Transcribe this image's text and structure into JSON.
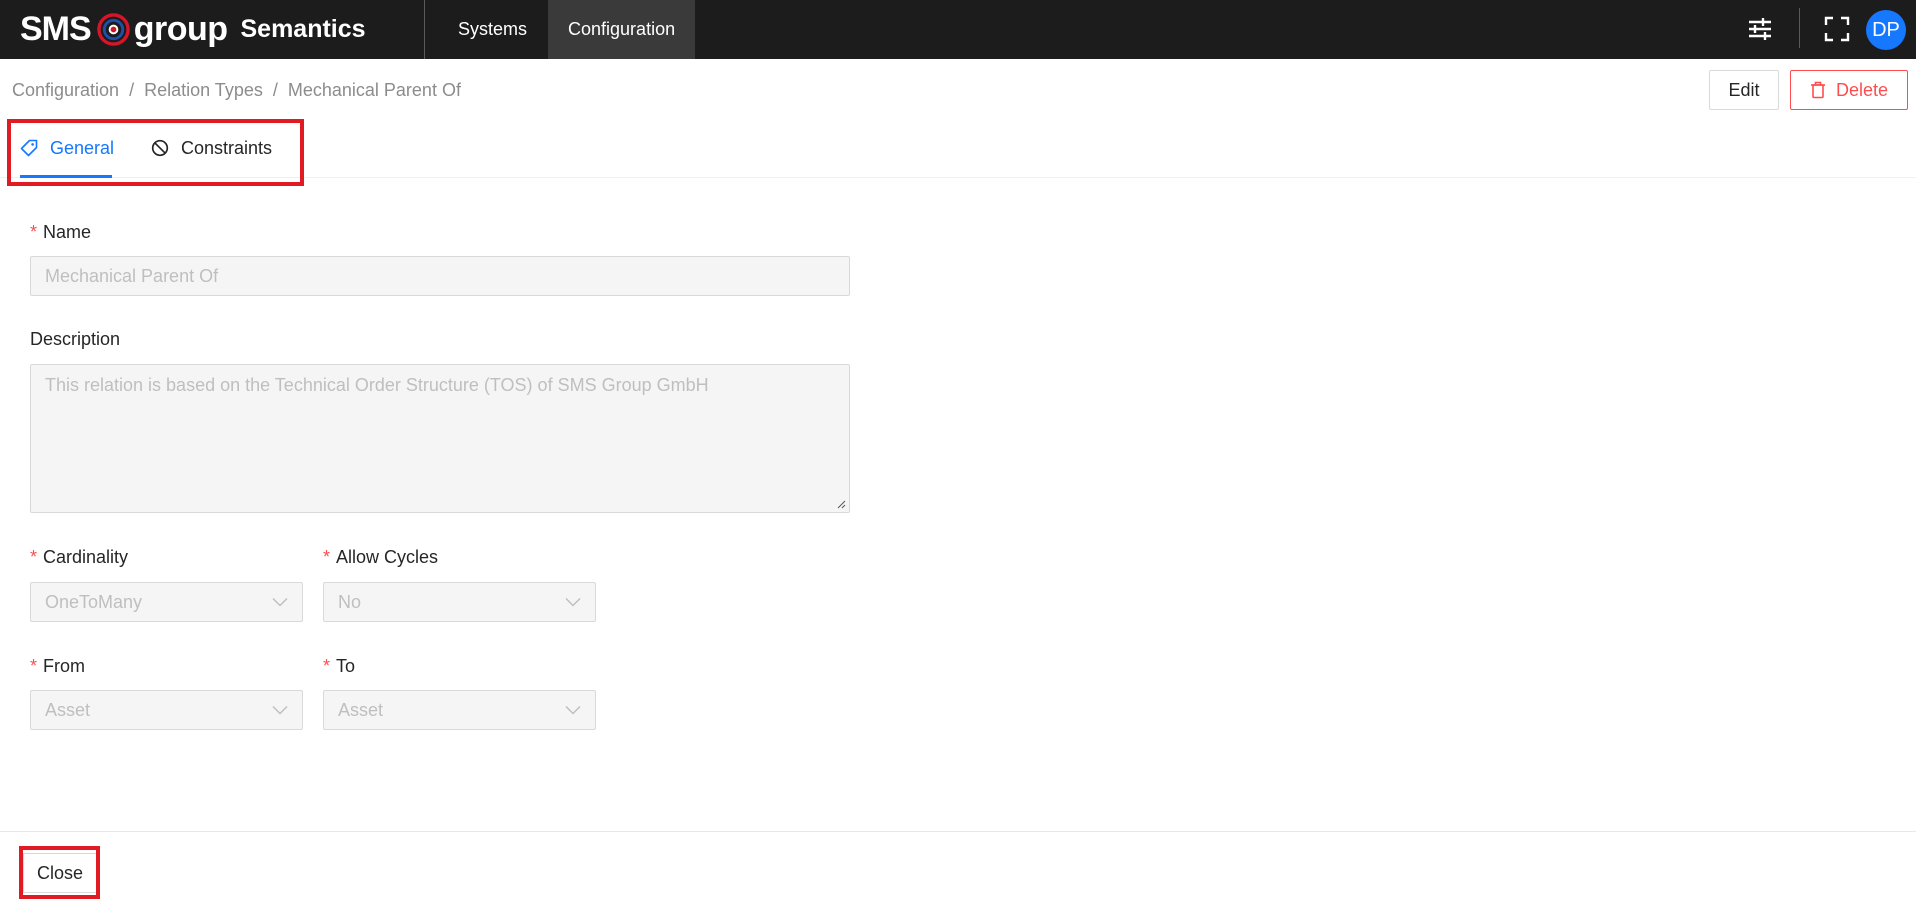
{
  "header": {
    "brand_sms": "SMS",
    "brand_group": "group",
    "brand_product": "Semantics",
    "nav": [
      {
        "label": "Systems",
        "active": false
      },
      {
        "label": "Configuration",
        "active": true
      }
    ],
    "avatar_initials": "DP",
    "icons": {
      "settings": "sliders-icon",
      "fullscreen": "fullscreen-icon"
    }
  },
  "breadcrumb": {
    "items": [
      "Configuration",
      "Relation Types",
      "Mechanical Parent Of"
    ],
    "separator": "/"
  },
  "actions": {
    "edit_label": "Edit",
    "delete_label": "Delete"
  },
  "tabs": [
    {
      "label": "General",
      "icon": "tag-icon",
      "active": true
    },
    {
      "label": "Constraints",
      "icon": "stop-icon",
      "active": false
    }
  ],
  "form": {
    "required_mark": "*",
    "name": {
      "label": "Name",
      "value": "Mechanical Parent Of"
    },
    "description": {
      "label": "Description",
      "value": "This relation is based on the Technical Order Structure (TOS) of SMS Group GmbH"
    },
    "cardinality": {
      "label": "Cardinality",
      "value": "OneToMany"
    },
    "allow_cycles": {
      "label": "Allow Cycles",
      "value": "No"
    },
    "from": {
      "label": "From",
      "value": "Asset"
    },
    "to": {
      "label": "To",
      "value": "Asset"
    }
  },
  "footer": {
    "close_label": "Close"
  },
  "colors": {
    "topbar": "#1c1c1c",
    "accent": "#1677ff",
    "danger": "#ff4d4f",
    "highlight": "#e01b24"
  }
}
